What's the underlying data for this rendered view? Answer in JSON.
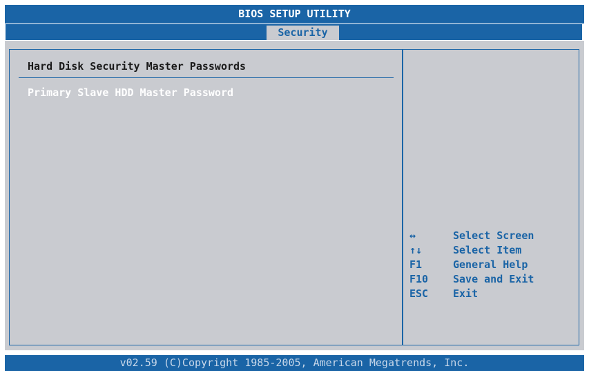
{
  "window": {
    "title": "BIOS SETUP UTILITY"
  },
  "tabs": {
    "active_label": "Security"
  },
  "main": {
    "section_heading": "Hard Disk Security Master Passwords",
    "items": [
      {
        "label": "Primary Slave HDD Master Password"
      }
    ]
  },
  "help": {
    "rows": [
      {
        "key": "↔",
        "key_icon": "left-right-arrow-icon",
        "action": "Select Screen"
      },
      {
        "key": "↑↓",
        "key_icon": "up-down-arrow-icon",
        "action": "Select Item"
      },
      {
        "key": "F1",
        "action": "General Help"
      },
      {
        "key": "F10",
        "action": "Save and Exit"
      },
      {
        "key": "ESC",
        "action": "Exit"
      }
    ]
  },
  "footer": {
    "text": "v02.59 (C)Copyright 1985-2005, American Megatrends, Inc."
  },
  "colors": {
    "bios_blue": "#1a64a6",
    "panel_gray": "#c9cbd0",
    "highlight_text": "#ffffff",
    "heading_text": "#1a1a1a"
  }
}
